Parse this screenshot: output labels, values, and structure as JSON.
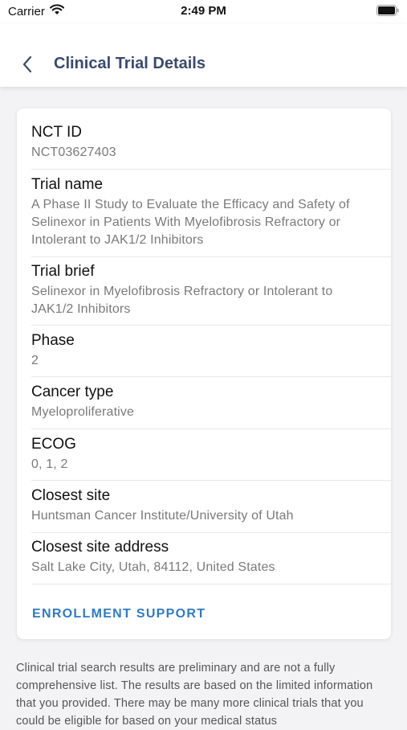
{
  "status_bar": {
    "carrier": "Carrier",
    "time": "2:49 PM",
    "icons": [
      "wifi-icon",
      "battery-icon"
    ]
  },
  "nav": {
    "title": "Clinical Trial Details",
    "back_icon": "chevron-left-icon"
  },
  "fields": {
    "nct_id": {
      "label": "NCT ID",
      "value": "NCT03627403"
    },
    "trial_name": {
      "label": "Trial name",
      "value": "A Phase II Study to Evaluate the Efficacy and Safety of Selinexor in Patients With Myelofibrosis Refractory or Intolerant to JAK1/2 Inhibitors"
    },
    "trial_brief": {
      "label": "Trial brief",
      "value": "Selinexor in Myelofibrosis Refractory or Intolerant to JAK1/2 Inhibitors"
    },
    "phase": {
      "label": "Phase",
      "value": "2"
    },
    "cancer_type": {
      "label": "Cancer type",
      "value": "Myeloproliferative"
    },
    "ecog": {
      "label": "ECOG",
      "value": "0, 1, 2"
    },
    "closest_site": {
      "label": "Closest site",
      "value": "Huntsman Cancer Institute/University of Utah"
    },
    "closest_site_address": {
      "label": "Closest site address",
      "value": "Salt Lake City, Utah, 84112, United States"
    }
  },
  "enrollment_button": "ENROLLMENT SUPPORT",
  "disclaimer": "Clinical trial search results are preliminary and are not a fully comprehensive list. The results are based on the limited information that you provided. There may be many more clinical trials that you could be eligible for based on your medical status",
  "colors": {
    "nav_title": "#3a4a6e",
    "accent": "#2f7ac7",
    "value_text": "#7a7a7a",
    "background": "#f3f3f5"
  }
}
